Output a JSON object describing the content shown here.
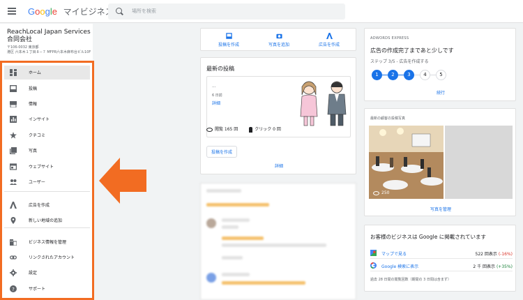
{
  "header": {
    "logo_word": [
      "G",
      "o",
      "o",
      "g",
      "l",
      "e"
    ],
    "product": "マイビジネス",
    "search_placeholder": "場所を検索"
  },
  "business": {
    "name": "ReachLocal Japan Services 合同会社",
    "address": "〒106-0032 東京都\n港区 六本木１丁目８−７ MFPR六本木麻布台ビル10F"
  },
  "sidebar": {
    "items": [
      {
        "label": "ホーム",
        "icon": "dashboard-icon"
      },
      {
        "label": "投稿",
        "icon": "post-icon"
      },
      {
        "label": "情報",
        "icon": "store-icon"
      },
      {
        "label": "インサイト",
        "icon": "insights-icon"
      },
      {
        "label": "クチコミ",
        "icon": "star-icon"
      },
      {
        "label": "写真",
        "icon": "photos-icon"
      },
      {
        "label": "ウェブサイト",
        "icon": "website-icon"
      },
      {
        "label": "ユーザー",
        "icon": "users-icon"
      },
      {
        "label": "広告を作成",
        "icon": "ads-icon"
      },
      {
        "label": "新しい地域の追加",
        "icon": "location-icon"
      },
      {
        "label": "ビジネス情報を管理",
        "icon": "building-icon"
      },
      {
        "label": "リンクされたアカウント",
        "icon": "link-icon"
      },
      {
        "label": "設定",
        "icon": "gear-icon"
      },
      {
        "label": "サポート",
        "icon": "help-icon"
      }
    ]
  },
  "actions": {
    "create_post": "投稿を作成",
    "add_photo": "写真を追加",
    "create_ad": "広告を作成"
  },
  "posts": {
    "title": "最新の投稿",
    "meta1": "...",
    "meta2": "6 日前",
    "detail": "詳細",
    "views": "閲覧 165 回",
    "clicks": "クリック 0 回",
    "create_button": "投稿を作成",
    "detail_link": "詳細"
  },
  "ads": {
    "label": "ADWORDS EXPRESS",
    "title": "広告の作成完了まであと少しです",
    "step_text": "ステップ 3/5 - 広告を作成する",
    "steps": [
      "1",
      "2",
      "3",
      "4",
      "5"
    ],
    "continue": "続行"
  },
  "photos": {
    "label": "最新の顧客の投稿写真",
    "count": "250",
    "manage": "写真を管理"
  },
  "search_presence": {
    "title": "お客様のビジネスは Google に掲載されています",
    "maps_label": "マップで見る",
    "maps_value": "522 回表示",
    "maps_delta": "(-16%)",
    "search_label": "Google 検索に表示",
    "search_value": "2 千 回表示",
    "search_delta": "(+35%)",
    "footer": "過去 28 日間の閲覧回数（期間の 3 日間は含まず）"
  },
  "colors": {
    "accent": "#1a73e8",
    "highlight_border": "#f26c22",
    "negative": "#d93025",
    "positive": "#188038"
  }
}
